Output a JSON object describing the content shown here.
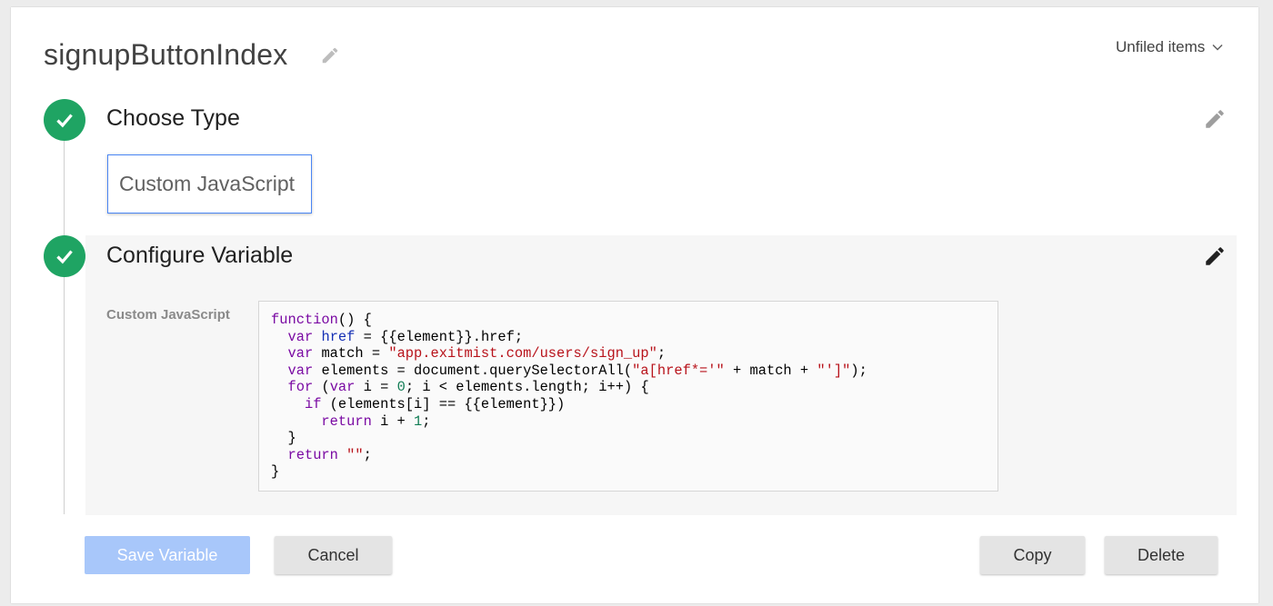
{
  "header": {
    "variable_name": "signupButtonIndex",
    "folder": "Unfiled items"
  },
  "steps": [
    {
      "title": "Choose Type",
      "status": "complete"
    },
    {
      "title": "Configure Variable",
      "status": "complete"
    }
  ],
  "choose_type": {
    "selected": "Custom JavaScript"
  },
  "configure": {
    "field_label": "Custom JavaScript",
    "code": [
      "function() {",
      "  var href = {{element}}.href;",
      "  var match = \"app.exitmist.com/users/sign_up\";",
      "  var elements = document.querySelectorAll(\"a[href*='\" + match + \"']\");",
      "  for (var i = 0; i < elements.length; i++) {",
      "    if (elements[i] == {{element}})",
      "      return i + 1;",
      "  }",
      "  return \"\";",
      "}"
    ]
  },
  "buttons": {
    "save": "Save Variable",
    "cancel": "Cancel",
    "copy": "Copy",
    "delete": "Delete"
  },
  "colors": {
    "step_complete": "#1fa463",
    "save_button": "#a8c7fa",
    "selected_border": "#4a86f5"
  }
}
